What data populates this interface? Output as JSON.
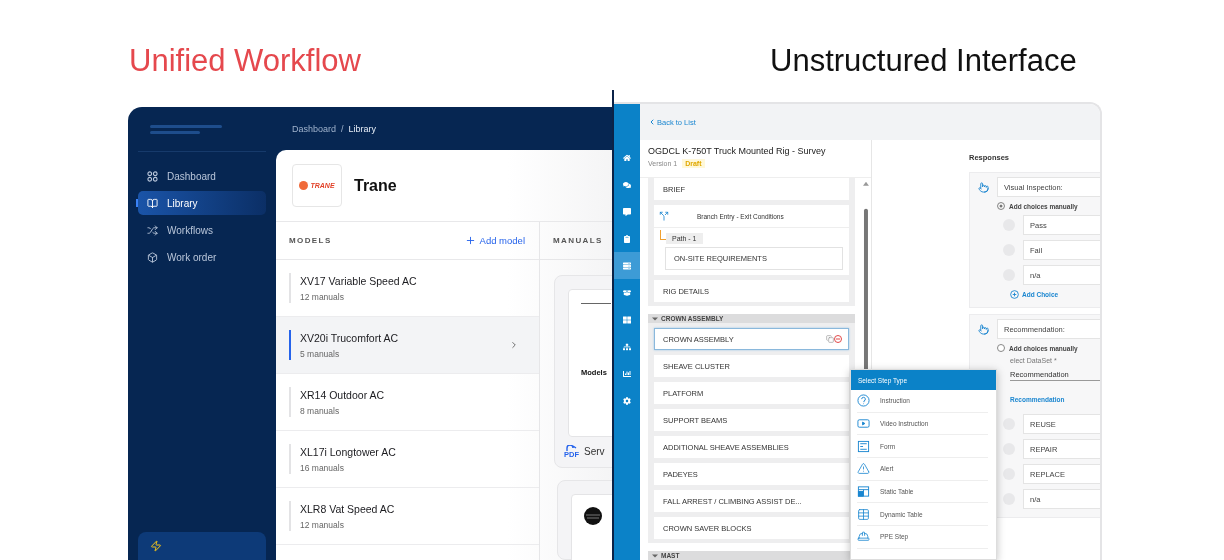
{
  "headings": {
    "left": "Unified Workflow",
    "right": "Unstructured Interface"
  },
  "unified": {
    "breadcrumb": [
      "Dashboard",
      "Library"
    ],
    "separator": "/",
    "nav": [
      {
        "label": "Dashboard",
        "selected": false
      },
      {
        "label": "Library",
        "selected": true
      },
      {
        "label": "Workflows",
        "selected": false
      },
      {
        "label": "Work order",
        "selected": false
      }
    ],
    "brand": {
      "name": "Trane",
      "logo_text": "TRANE"
    },
    "models": {
      "title": "MODELS",
      "add_label": "Add model",
      "items": [
        {
          "name": "XV17 Variable Speed AC",
          "count": "12 manuals",
          "selected": false
        },
        {
          "name": "XV20i Trucomfort AC",
          "count": "5 manuals",
          "selected": true
        },
        {
          "name": "XR14 Outdoor AC",
          "count": "8 manuals",
          "selected": false
        },
        {
          "name": "XL17i Longtower AC",
          "count": "16 manuals",
          "selected": false
        },
        {
          "name": "XLR8 Vat Speed AC",
          "count": "12 manuals",
          "selected": false
        }
      ]
    },
    "manuals": {
      "title": "MANUALS",
      "card_title": "Models",
      "file_type": "PDF",
      "file_name": "Serv"
    }
  },
  "unstructured": {
    "back_label": "Back to List",
    "nav": [
      {
        "selected": false
      },
      {
        "selected": false
      },
      {
        "selected": false
      },
      {
        "selected": false
      },
      {
        "selected": true
      },
      {
        "selected": false
      },
      {
        "selected": false
      },
      {
        "selected": false
      },
      {
        "selected": false
      },
      {
        "selected": false
      }
    ],
    "title": "OGDCL K-750T Truck Mounted Rig - Survey",
    "version": "Version 1",
    "status": "Draft",
    "top_steps": [
      {
        "kind": "step",
        "label": "BRIEF"
      },
      {
        "kind": "branch",
        "label": "Branch Entry - Exit Conditions",
        "path": "Path - 1",
        "children": [
          {
            "label": "ON-SITE REQUIREMENTS"
          }
        ]
      },
      {
        "kind": "step",
        "label": "RIG DETAILS"
      }
    ],
    "sections": [
      {
        "label": "CROWN ASSEMBLY",
        "expanded": true,
        "children": [
          {
            "label": "CROWN ASSEMBLY",
            "selected": true
          },
          {
            "label": "SHEAVE CLUSTER",
            "selected": false
          },
          {
            "label": "PLATFORM",
            "selected": false
          },
          {
            "label": "SUPPORT BEAMS",
            "selected": false
          },
          {
            "label": "ADDITIONAL SHEAVE ASSEMBLIES",
            "selected": false
          },
          {
            "label": "PADEYES",
            "selected": false
          },
          {
            "label": "FALL ARREST / CLIMBING ASSIST DE...",
            "selected": false
          },
          {
            "label": "CROWN SAVER BLOCKS",
            "selected": false
          }
        ]
      },
      {
        "label": "MAST",
        "expanded": true
      }
    ],
    "responses": {
      "title": "Responses",
      "cards": [
        {
          "field": "Visual Inspection:",
          "mode_label": "Add choices manually",
          "manual": true,
          "choices": [
            {
              "label": "Pass",
              "selected": false
            },
            {
              "label": "Fail",
              "selected": false
            },
            {
              "label": "n/a",
              "selected": false
            }
          ],
          "add_label": "Add Choice"
        },
        {
          "field": "Recommendation:",
          "mode_label": "Add choices manually",
          "manual": false,
          "dataset_label": "elect DataSet *",
          "dataset": "Recommendation",
          "dataset_link": "Recommendation",
          "choices": [
            {
              "label": "REUSE",
              "selected": false
            },
            {
              "label": "REPAIR",
              "selected": false
            },
            {
              "label": "REPLACE",
              "selected": false
            },
            {
              "label": "n/a",
              "selected": false
            }
          ]
        }
      ]
    },
    "step_menu": {
      "title": "Select Step Type",
      "items": [
        {
          "label": "Instruction"
        },
        {
          "label": "Video Instruction"
        },
        {
          "label": "Form"
        },
        {
          "label": "Alert"
        },
        {
          "label": "Static Table"
        },
        {
          "label": "Dynamic Table"
        },
        {
          "label": "PPE Step"
        }
      ]
    }
  }
}
